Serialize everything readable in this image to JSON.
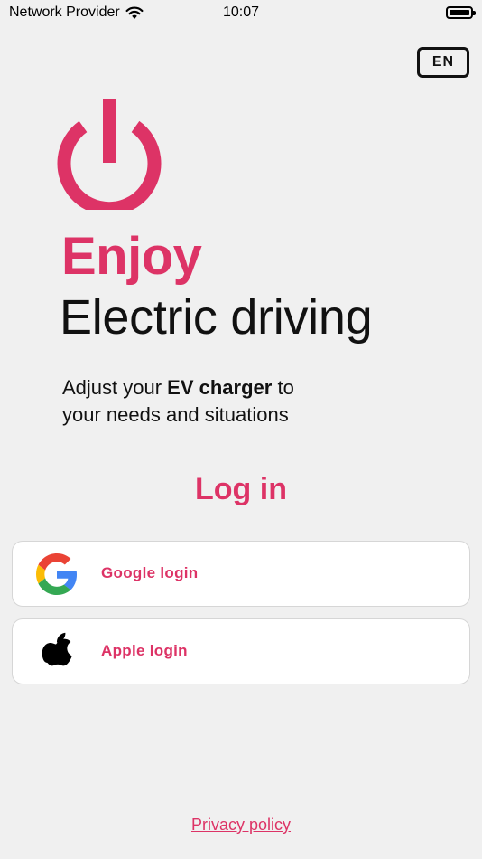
{
  "status_bar": {
    "carrier": "Network Provider",
    "time": "10:07",
    "wifi_icon": "wifi-icon",
    "battery_icon": "battery-icon"
  },
  "language": {
    "label": "EN"
  },
  "hero": {
    "logo_icon": "power-icon",
    "title": "Enjoy",
    "subtitle": "Electric driving"
  },
  "description": {
    "part1": "Adjust your ",
    "bold": "EV charger",
    "part2": " to",
    "line2": "your needs and situations"
  },
  "login": {
    "heading": "Log in",
    "options": [
      {
        "label": "Google login",
        "icon": "google-icon"
      },
      {
        "label": "Apple login",
        "icon": "apple-icon"
      }
    ]
  },
  "footer": {
    "privacy_link": "Privacy policy"
  },
  "colors": {
    "accent": "#dd3366",
    "background": "#f0f0f0",
    "text": "#111111",
    "card": "#ffffff"
  }
}
